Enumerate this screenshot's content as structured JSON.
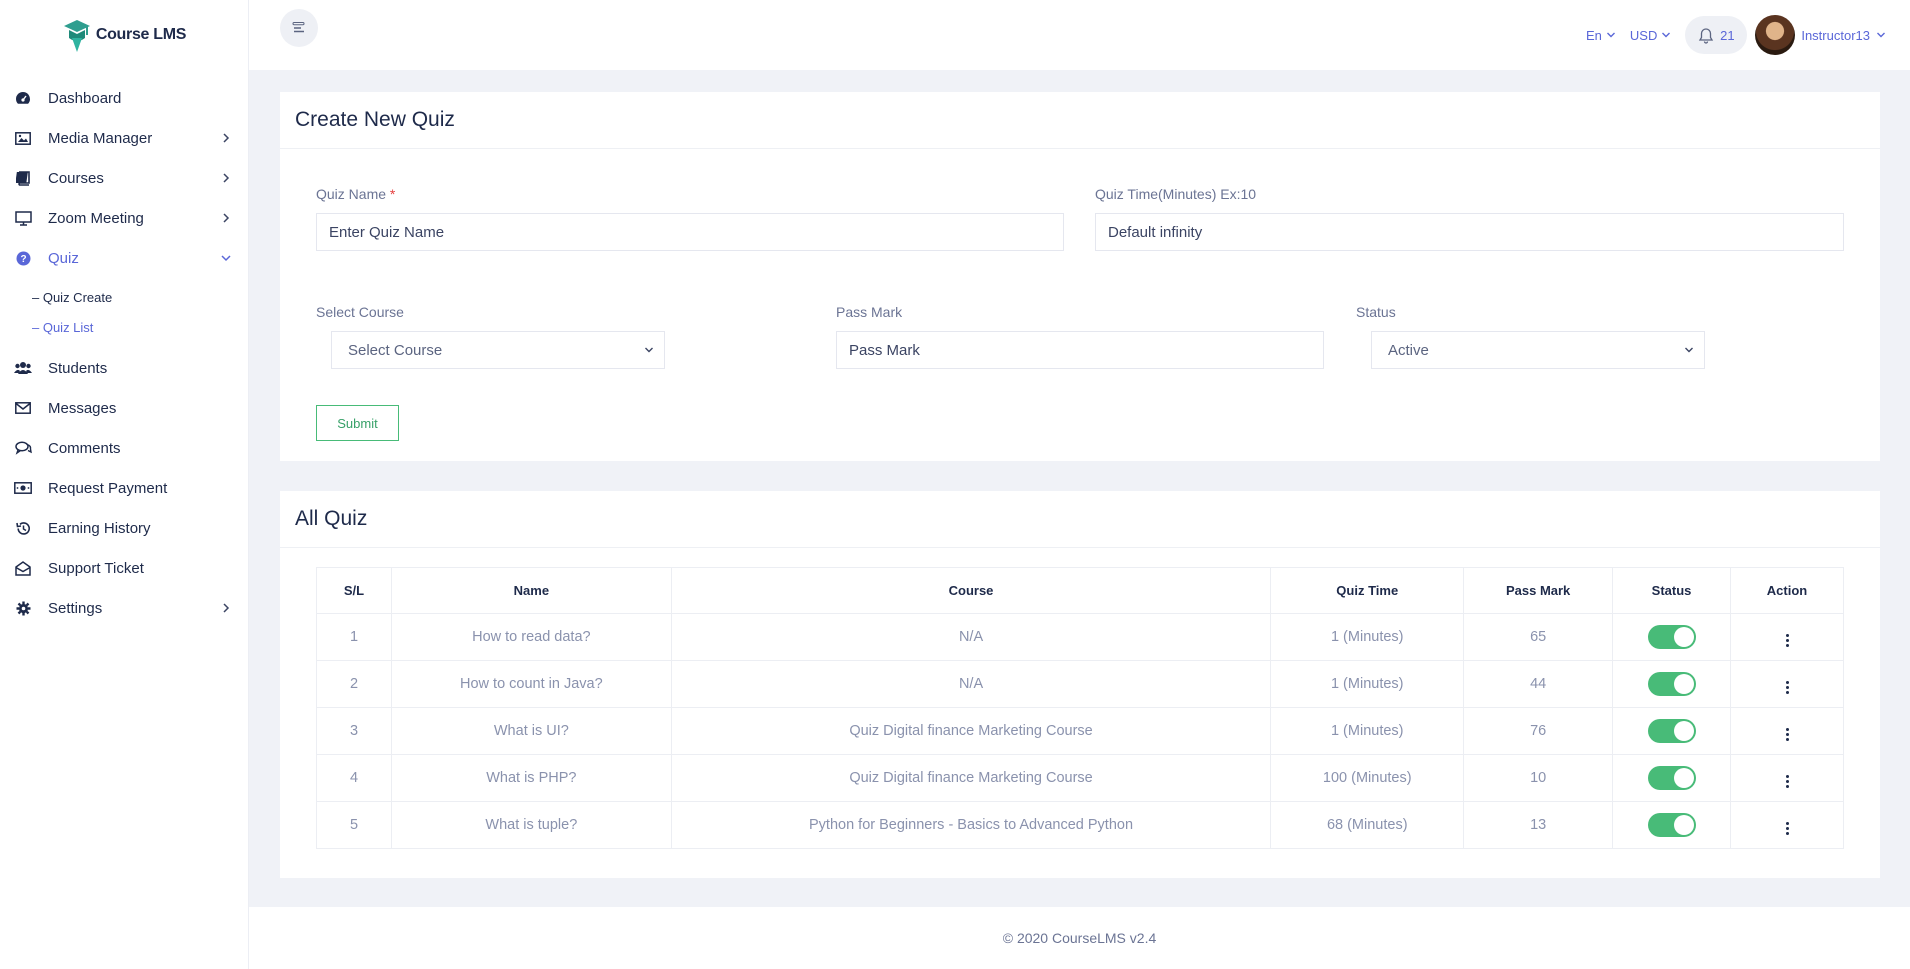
{
  "brand": {
    "name": "Course LMS"
  },
  "sidebar": {
    "items": [
      {
        "label": "Dashboard",
        "icon": "dashboard-icon",
        "has_chevron": false
      },
      {
        "label": "Media Manager",
        "icon": "image-icon",
        "has_chevron": true
      },
      {
        "label": "Courses",
        "icon": "book-icon",
        "has_chevron": true
      },
      {
        "label": "Zoom Meeting",
        "icon": "monitor-icon",
        "has_chevron": true
      },
      {
        "label": "Quiz",
        "icon": "question-icon",
        "has_chevron": true,
        "expanded": true
      },
      {
        "label": "Students",
        "icon": "users-icon",
        "has_chevron": false
      },
      {
        "label": "Messages",
        "icon": "envelope-icon",
        "has_chevron": false
      },
      {
        "label": "Comments",
        "icon": "comments-icon",
        "has_chevron": false
      },
      {
        "label": "Request Payment",
        "icon": "money-icon",
        "has_chevron": false
      },
      {
        "label": "Earning History",
        "icon": "history-icon",
        "has_chevron": false
      },
      {
        "label": "Support Ticket",
        "icon": "envelope-open-icon",
        "has_chevron": false
      },
      {
        "label": "Settings",
        "icon": "gear-icon",
        "has_chevron": true
      }
    ],
    "quiz_sub": [
      {
        "label": "– Quiz Create"
      },
      {
        "label": "– Quiz List"
      }
    ]
  },
  "header": {
    "language": "En",
    "currency": "USD",
    "notification_count": "21",
    "user_name": "Instructor13"
  },
  "create_quiz": {
    "title": "Create New Quiz",
    "quiz_name_label": "Quiz Name",
    "required_mark": "*",
    "quiz_name_placeholder": "Enter Quiz Name",
    "quiz_time_label": "Quiz Time(Minutes) Ex:10",
    "quiz_time_placeholder": "Default infinity",
    "course_label": "Select Course",
    "course_value": "Select Course",
    "pass_mark_label": "Pass Mark",
    "pass_mark_placeholder": "Pass Mark",
    "status_label": "Status",
    "status_value": "Active",
    "submit_label": "Submit"
  },
  "all_quiz": {
    "title": "All Quiz",
    "columns": [
      "S/L",
      "Name",
      "Course",
      "Quiz Time",
      "Pass Mark",
      "Status",
      "Action"
    ],
    "rows": [
      {
        "sl": "1",
        "name": "How to read data?",
        "course": "N/A",
        "time": "1 (Minutes)",
        "pass": "65",
        "active": true
      },
      {
        "sl": "2",
        "name": "How to count in Java?",
        "course": "N/A",
        "time": "1 (Minutes)",
        "pass": "44",
        "active": true
      },
      {
        "sl": "3",
        "name": "What is UI?",
        "course": "Quiz Digital finance Marketing Course",
        "time": "1 (Minutes)",
        "pass": "76",
        "active": true
      },
      {
        "sl": "4",
        "name": "What is PHP?",
        "course": "Quiz Digital finance Marketing Course",
        "time": "100 (Minutes)",
        "pass": "10",
        "active": true
      },
      {
        "sl": "5",
        "name": "What is tuple?",
        "course": "Python for Beginners - Basics to Advanced Python",
        "time": "68 (Minutes)",
        "pass": "13",
        "active": true
      }
    ]
  },
  "footer": {
    "text": "© 2020 CourseLMS v2.4"
  },
  "colors": {
    "accent": "#5a67d8",
    "success": "#48bb78",
    "text": "#1e2a4a"
  }
}
